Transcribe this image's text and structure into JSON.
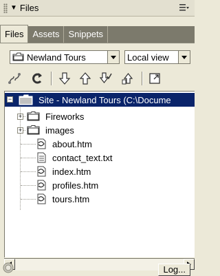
{
  "panel": {
    "title": "Files"
  },
  "tabs": [
    "Files",
    "Assets",
    "Snippets"
  ],
  "site_select": {
    "value": "Newland Tours"
  },
  "view_select": {
    "value": "Local view"
  },
  "tree": {
    "root_label": "Site - Newland Tours (C:\\Docume",
    "folders": [
      "Fireworks",
      "images"
    ],
    "files": [
      "about.htm",
      "contact_text.txt",
      "index.htm",
      "profiles.htm",
      "tours.htm"
    ]
  },
  "log_button": "Log...",
  "colors": {
    "selection": "#0a246a",
    "panel_bg": "#ece9d8",
    "tab_inactive": "#7c7a6c"
  }
}
